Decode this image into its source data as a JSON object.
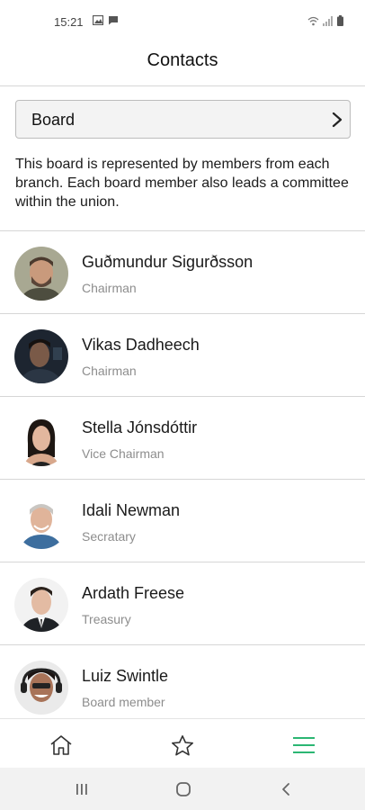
{
  "status": {
    "time": "15:21"
  },
  "header": {
    "title": "Contacts"
  },
  "board_select": {
    "label": "Board"
  },
  "board_description": "This board is represented by members from each branch. Each board member also leads a committee within the union.",
  "contacts": [
    {
      "name": "Guðmundur Sigurðsson",
      "role": "Chairman"
    },
    {
      "name": "Vikas Dadheech",
      "role": "Chairman"
    },
    {
      "name": "Stella Jónsdóttir",
      "role": "Vice Chairman"
    },
    {
      "name": "Idali Newman",
      "role": "Secratary"
    },
    {
      "name": "Ardath Freese",
      "role": "Treasury"
    },
    {
      "name": "Luiz Swintle",
      "role": "Board member"
    }
  ],
  "bottom_nav": {
    "items": [
      "home-icon",
      "star-icon",
      "menu-icon"
    ],
    "active_color": "#2bb673"
  },
  "system_nav": {
    "items": [
      "recents-icon",
      "home-circle-icon",
      "back-icon"
    ]
  }
}
